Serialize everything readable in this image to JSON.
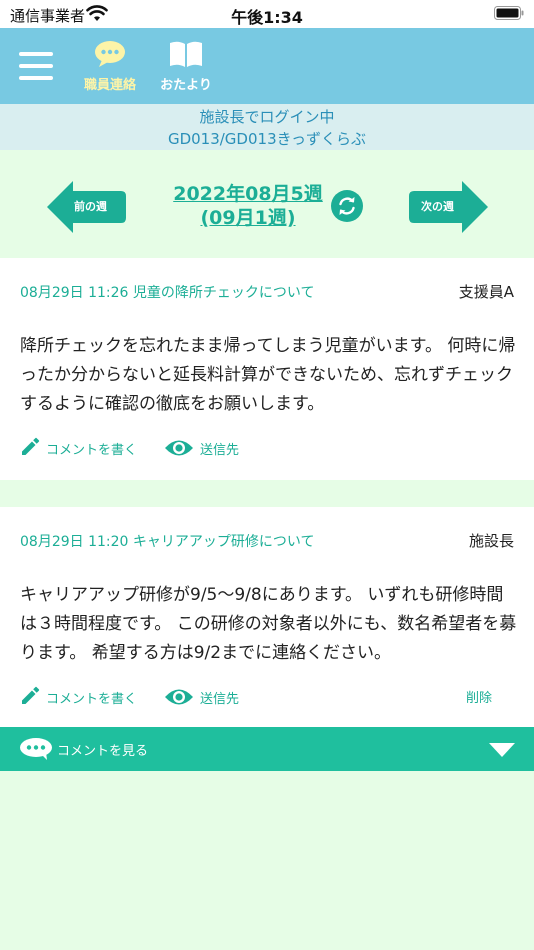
{
  "status_bar": {
    "carrier": "通信事業者",
    "time": "午後1:34"
  },
  "app_bar": {
    "menu_icon": "hamburger-menu-icon",
    "tabs": [
      {
        "label": "職員連絡",
        "icon": "chat-bubble-icon",
        "active": true
      },
      {
        "label": "おたより",
        "icon": "open-book-icon",
        "active": false
      }
    ]
  },
  "login_info": {
    "line1": "施設長でログイン中",
    "line2": "GD013/GD013きっずくらぶ"
  },
  "week_nav": {
    "prev_label": "前の週",
    "next_label": "次の週",
    "title_line1": "2022年08月5週",
    "title_line2": "(09月1週)",
    "refresh_icon": "refresh-icon"
  },
  "posts": [
    {
      "meta": "08月29日 11:26 児童の降所チェックについて",
      "author": "支援員A",
      "body": "降所チェックを忘れたまま帰ってしまう児童がいます。 何時に帰ったか分からないと延長料計算ができないため、忘れずチェックするように確認の徹底をお願いします。",
      "comment_label": "コメントを書く",
      "recipients_label": "送信先"
    },
    {
      "meta": "08月29日 11:20 キャリアアップ研修について",
      "author": "施設長",
      "body": "キャリアアップ研修が9/5〜9/8にあります。 いずれも研修時間は３時間程度です。 この研修の対象者以外にも、数名希望者を募ります。 希望する方は9/2までに連絡ください。",
      "comment_label": "コメントを書く",
      "recipients_label": "送信先",
      "delete_label": "削除"
    }
  ],
  "comments_bar": {
    "label": "コメントを見る"
  },
  "colors": {
    "app_bar": "#78c9e2",
    "accent_teal": "#1cae96",
    "active_tab": "#fdf4a8",
    "background": "#e6fde6",
    "login_bar": "#d9eef0"
  }
}
